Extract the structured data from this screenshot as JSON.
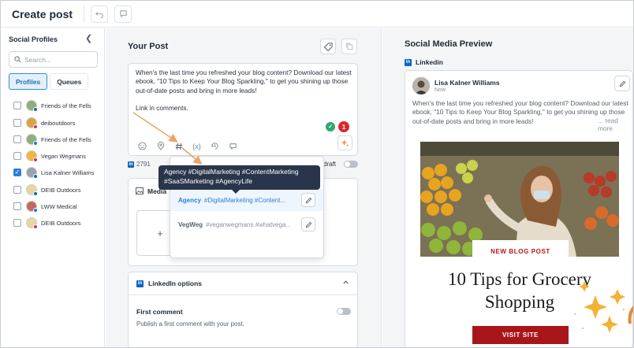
{
  "header": {
    "title": "Create post"
  },
  "sidebar": {
    "title": "Social Profiles",
    "search_placeholder": "Search...",
    "tabs": [
      {
        "label": "Profiles",
        "active": true
      },
      {
        "label": "Queues",
        "active": false
      }
    ],
    "profiles": [
      {
        "name": "Friends of the Fells",
        "checked": false
      },
      {
        "name": "deiboutdoors",
        "checked": false
      },
      {
        "name": "Friends of the Fells",
        "checked": false
      },
      {
        "name": "Vegan Wegmans",
        "checked": false
      },
      {
        "name": "Lisa Kalner Williams",
        "checked": true
      },
      {
        "name": "DEIB Outdoors",
        "checked": false
      },
      {
        "name": "LWW Medical",
        "checked": false
      },
      {
        "name": "DEIB Outdoors",
        "checked": false
      }
    ]
  },
  "post": {
    "title": "Your Post",
    "text_p1": "When's the last time you refreshed your blog content? Download our latest ebook, \"10 Tips to Keep Your Blog Sparkling,\" to get you shining up those out-of-date posts and bring in more leads!",
    "text_p2": "Link in comments.",
    "grammar_badge": "1",
    "char_count": "2791",
    "draft_label": "draft"
  },
  "media": {
    "title": "Media",
    "add_symbol": "+"
  },
  "hashtags": {
    "tooltip": "Agency #DigitalMarketing #ContentMarketing #SaaSMarketing #AgencyLife",
    "groups": [
      {
        "name": "Agency",
        "tags": "#DigitalMarketing #Content..."
      },
      {
        "name": "VegWeg",
        "tags": "#veganwegmans #whatvega..."
      }
    ]
  },
  "linkedin_options": {
    "title": "LinkedIn options",
    "first_comment_title": "First comment",
    "first_comment_desc": "Publish a first comment with your post."
  },
  "preview": {
    "title": "Social Media Preview",
    "network": "Linkedin",
    "author": "Lisa Kalner Williams",
    "time": "Now",
    "text": "When's the last time you refreshed your blog content? Download our latest ebook, \"10 Tips to Keep Your Blog Sparkling,\" to get you shining up those out-of-date posts and bring in more leads!",
    "read_more": "... read more",
    "image": {
      "badge": "NEW BLOG POST",
      "headline_line1": "10 Tips for Grocery",
      "headline_line2": "Shopping",
      "cta": "VISIT SITE"
    }
  },
  "colors": {
    "accent": "#2f7fd6",
    "linkedin": "#0a66c2",
    "brand_red": "#a8161a",
    "arrow": "#e9a466"
  }
}
